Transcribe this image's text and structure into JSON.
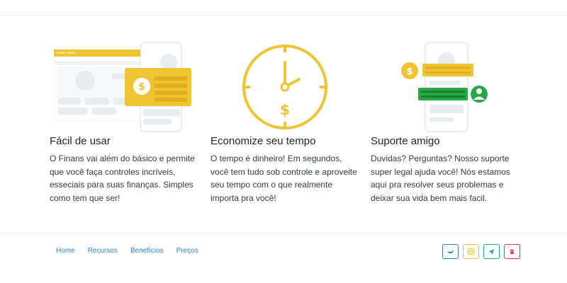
{
  "features": [
    {
      "title": "Fácil de usar",
      "text": "O Finans vai além do básico e permite que você faça controles incríveis, esseciais para suas finanças. Simples como tem que ser!",
      "icon": "dashboard-card-illustration"
    },
    {
      "title": "Economize seu tempo",
      "text": "O tempo é dinheiro! Em segundos, você tem tudo sob controle e aproveite seu tempo com o que realmente importa pra você!",
      "icon": "clock-money-illustration"
    },
    {
      "title": "Suporte amigo",
      "text": "Duvidas? Perguntas? Nosso suporte super legal ajuda você! Nós estamos aqui pra resolver seus problemas e deixar sua vida bem mais facil.",
      "icon": "chat-support-illustration"
    }
  ],
  "footer": {
    "nav": [
      "Home",
      "Recursos",
      "Benefícios",
      "Preços"
    ],
    "social": [
      {
        "icon": "twitter-icon",
        "color": "#2f7fc6"
      },
      {
        "icon": "instagram-icon",
        "color": "#f0c332"
      },
      {
        "icon": "telegram-icon",
        "color": "#17a2b8"
      },
      {
        "icon": "app-store-icon",
        "color": "#dc3545"
      }
    ]
  },
  "colors": {
    "accent": "#f0c332",
    "green": "#28a745",
    "link": "#2f7fc6",
    "placeholder": "#e9ecef"
  }
}
